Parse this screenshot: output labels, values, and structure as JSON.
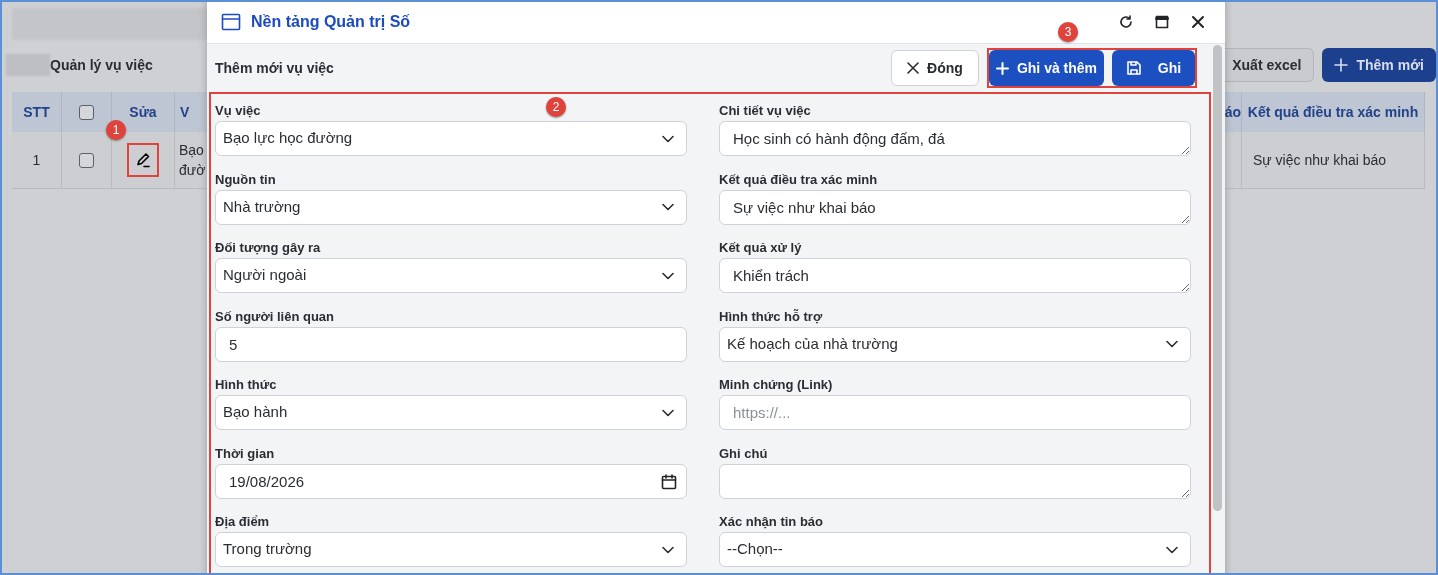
{
  "background_page": {
    "heading": "Quản lý vụ việc",
    "buttons": [
      {
        "label": "Xuất excel",
        "kind": "outline"
      },
      {
        "label": "Thêm mới",
        "kind": "primary"
      }
    ],
    "table": {
      "left_columns": [
        {
          "kind": "text",
          "label": "STT"
        },
        {
          "kind": "checkbox",
          "checked": false
        },
        {
          "kind": "text",
          "label": "Sửa"
        },
        {
          "kind": "text",
          "label": "V"
        }
      ],
      "right_columns": [
        "áo",
        "Kết quả điều tra xác minh"
      ],
      "rows": [
        {
          "stt": "1",
          "checked": false,
          "column_4": "Bạo đườ",
          "result": "Sự việc như khai báo"
        }
      ]
    }
  },
  "dialog": {
    "title": "Nền tảng Quản trị Số",
    "subtitle": "Thêm mới vụ việc",
    "buttons": [
      {
        "label": "Đóng",
        "kind": "close"
      },
      {
        "label": "Ghi và thêm",
        "kind": "add"
      },
      {
        "label": "Ghi",
        "kind": "save"
      }
    ],
    "fields_left": [
      {
        "label": "Vụ việc",
        "kind": "select",
        "value": "Bạo lực học đường"
      },
      {
        "label": "Nguồn tin",
        "kind": "select",
        "value": "Nhà trường"
      },
      {
        "label": "Đối tượng gây ra",
        "kind": "select",
        "value": "Người ngoài"
      },
      {
        "label": "Số người liên quan",
        "kind": "input",
        "value": "5"
      },
      {
        "label": "Hình thức",
        "kind": "select",
        "value": "Bạo hành"
      },
      {
        "label": "Thời gian",
        "kind": "date",
        "value": "19/08/2026"
      },
      {
        "label": "Địa điểm",
        "kind": "select",
        "value": "Trong trường"
      }
    ],
    "fields_right": [
      {
        "label": "Chi tiết vụ việc",
        "kind": "textarea",
        "value": "Học sinh có hành động đấm, đá"
      },
      {
        "label": "Kết quả điều tra xác minh",
        "kind": "textarea",
        "value": "Sự việc như khai báo"
      },
      {
        "label": "Kết quả xử lý",
        "kind": "textarea",
        "value": "Khiển trách"
      },
      {
        "label": "Hình thức hỗ trợ",
        "kind": "select",
        "value": "Kế hoạch của nhà trường"
      },
      {
        "label": "Minh chứng (Link)",
        "kind": "input",
        "placeholder": "https://..."
      },
      {
        "label": "Ghi chú",
        "kind": "textarea"
      },
      {
        "label": "Xác nhận tin báo",
        "kind": "select",
        "value": "--Chọn--"
      }
    ]
  },
  "annotations": [
    {
      "number": "1"
    },
    {
      "number": "2"
    },
    {
      "number": "3"
    }
  ]
}
